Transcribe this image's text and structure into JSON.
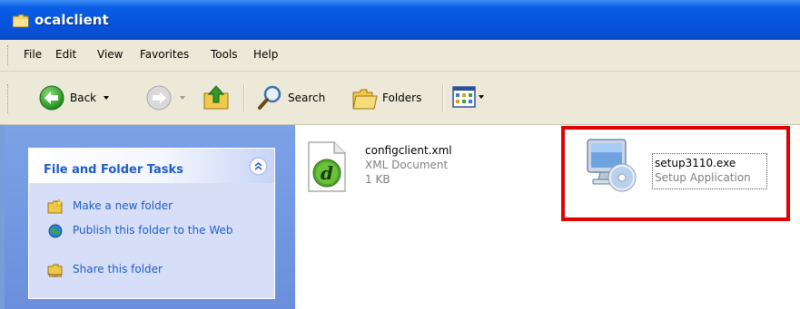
{
  "window": {
    "title": "ocalclient",
    "icon": "folder-icon"
  },
  "menu": {
    "items": [
      "File",
      "Edit",
      "View",
      "Favorites",
      "Tools",
      "Help"
    ]
  },
  "toolbar": {
    "back_label": "Back",
    "search_label": "Search",
    "folders_label": "Folders"
  },
  "tasks": {
    "title": "File and Folder Tasks",
    "items": [
      {
        "label": "Make a new folder",
        "icon": "new-folder-icon"
      },
      {
        "label": "Publish this folder to the Web",
        "icon": "publish-web-icon"
      },
      {
        "label": "Share this folder",
        "icon": "share-folder-icon"
      }
    ]
  },
  "files": [
    {
      "name": "configclient.xml",
      "type": "XML Document",
      "size": "1 KB",
      "icon": "xml-document-icon"
    },
    {
      "name": "setup3110.exe",
      "type": "Setup Application",
      "icon": "setup-application-icon"
    }
  ],
  "colors": {
    "title_bar": "#0554e0",
    "task_link": "#215dc6",
    "highlight": "#e00000"
  }
}
